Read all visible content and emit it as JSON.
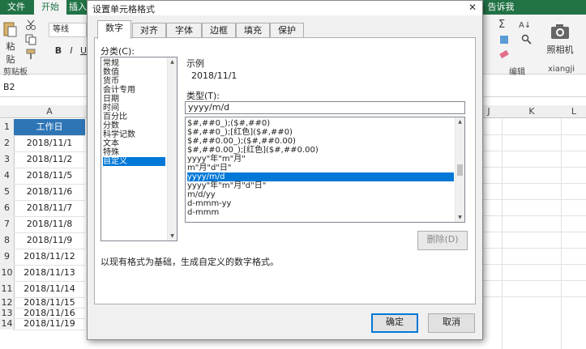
{
  "ribbon": {
    "tabs": [
      "文件",
      "开始",
      "插入"
    ],
    "tell_me": "告诉我",
    "paste_label": "粘贴",
    "clipboard_label": "剪贴板",
    "font_name": "等线",
    "bold": "B",
    "italic": "I",
    "underline": "U",
    "editing_label": "编辑",
    "camera_label": "照相机",
    "user_label": "xiangji"
  },
  "formula_bar": {
    "name_box": "B2"
  },
  "sheet": {
    "columns": [
      "A",
      "J",
      "K",
      "L"
    ],
    "header_cell": "工作日",
    "rows": [
      "1",
      "2",
      "3",
      "4",
      "5",
      "6",
      "7",
      "8",
      "9",
      "10",
      "11",
      "12",
      "13",
      "14"
    ],
    "dates": [
      "2018/11/1",
      "2018/11/2",
      "2018/11/5",
      "2018/11/6",
      "2018/11/7",
      "2018/11/8",
      "2018/11/9",
      "2018/11/12",
      "2018/11/13",
      "2018/11/14",
      "2018/11/15",
      "2018/11/16",
      "2018/11/19"
    ]
  },
  "dialog": {
    "title": "设置单元格格式",
    "close": "✕",
    "tabs": [
      "数字",
      "对齐",
      "字体",
      "边框",
      "填充",
      "保护"
    ],
    "category_label": "分类(C):",
    "categories": [
      "常规",
      "数值",
      "货币",
      "会计专用",
      "日期",
      "时间",
      "百分比",
      "分数",
      "科学记数",
      "文本",
      "特殊",
      "自定义"
    ],
    "selected_category": "自定义",
    "sample_label": "示例",
    "sample_value": "2018/11/1",
    "type_label": "类型(T):",
    "type_value": "yyyy/m/d",
    "formats": [
      "$#,##0_);($#,##0)",
      "$#,##0_);[红色]($#,##0)",
      "$#,##0.00_);($#,##0.00)",
      "$#,##0.00_);[红色]($#,##0.00)",
      "yyyy\"年\"m\"月\"",
      "m\"月\"d\"日\"",
      "yyyy/m/d",
      "yyyy\"年\"m\"月\"d\"日\"",
      "m/d/yy",
      "d-mmm-yy",
      "d-mmm"
    ],
    "selected_format": "yyyy/m/d",
    "delete_button": "删除(D)",
    "hint": "以现有格式为基础，生成自定义的数字格式。",
    "ok": "确定",
    "cancel": "取消"
  },
  "colors": {
    "excel_green": "#217346",
    "selection_blue": "#0078d7",
    "header_blue": "#2e75b6"
  }
}
